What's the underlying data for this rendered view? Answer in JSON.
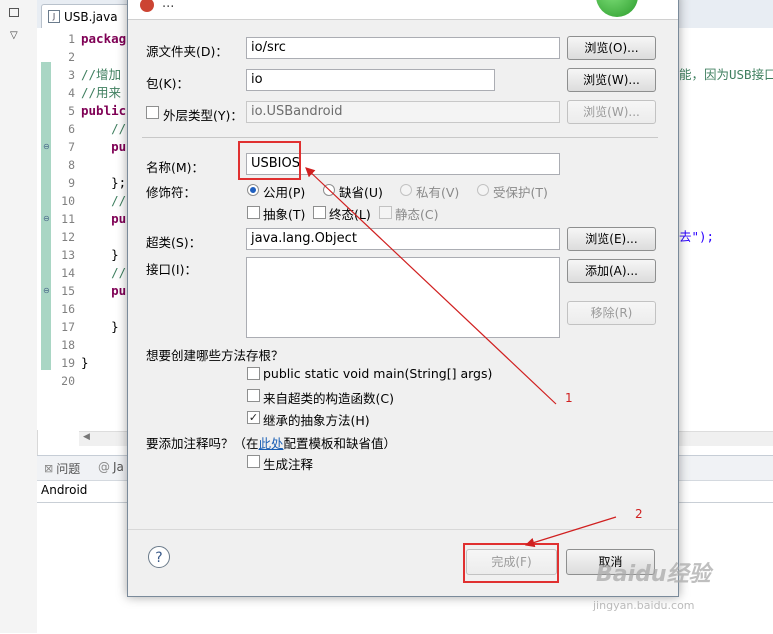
{
  "editor": {
    "tab_label": "USB.java",
    "line_numbers": [
      "1",
      "2",
      "3",
      "4",
      "5",
      "6",
      "7",
      "8",
      "9",
      "10",
      "11",
      "12",
      "13",
      "14",
      "15",
      "16",
      "17",
      "18",
      "19",
      "20"
    ],
    "code_lines": [
      {
        "text": "packag",
        "cls": "kw"
      },
      {
        "text": "",
        "cls": "plain"
      },
      {
        "text": "//增加",
        "cls": "cm"
      },
      {
        "text": "//用来",
        "cls": "cm"
      },
      {
        "text": "public",
        "cls": "kw"
      },
      {
        "text": "    //",
        "cls": "cm"
      },
      {
        "text": "    pu",
        "cls": "kw"
      },
      {
        "text": "",
        "cls": "plain"
      },
      {
        "text": "    };",
        "cls": "plain"
      },
      {
        "text": "    //",
        "cls": "cm"
      },
      {
        "text": "    pu",
        "cls": "kw"
      },
      {
        "text": "",
        "cls": "plain"
      },
      {
        "text": "    }",
        "cls": "plain"
      },
      {
        "text": "    //",
        "cls": "cm"
      },
      {
        "text": "    pu",
        "cls": "kw"
      },
      {
        "text": "",
        "cls": "plain"
      },
      {
        "text": "    }",
        "cls": "plain"
      },
      {
        "text": "",
        "cls": "plain"
      },
      {
        "text": "}",
        "cls": "plain"
      },
      {
        "text": "",
        "cls": "plain"
      }
    ],
    "right_fragment_line3": "能，因为USB接口",
    "right_fragment_line12": "去\");"
  },
  "bottom_panel": {
    "problems_tab": "问题",
    "javadoc_tab": "Ja",
    "content": "Android"
  },
  "dialog": {
    "title": "...",
    "source_folder_label": "源文件夹(D)：",
    "source_folder_value": "io/src",
    "browse_o": "浏览(O)...",
    "package_label": "包(K)：",
    "package_value": "io",
    "browse_w": "浏览(W)...",
    "enclosing_label": "外层类型(Y)：",
    "enclosing_value": "io.USBandroid",
    "browse_w2": "浏览(W)...",
    "name_label": "名称(M)：",
    "name_value": "USBIOS",
    "modifiers_label": "修饰符：",
    "mod_public": "公用(P)",
    "mod_default": "缺省(U)",
    "mod_private": "私有(V)",
    "mod_protected": "受保护(T)",
    "mod_abstract": "抽象(T)",
    "mod_final": "终态(L)",
    "mod_static": "静态(C)",
    "superclass_label": "超类(S)：",
    "superclass_value": "java.lang.Object",
    "browse_e": "浏览(E)...",
    "interfaces_label": "接口(I)：",
    "add_button": "添加(A)...",
    "remove_button": "移除(R)",
    "stubs_question": "想要创建哪些方法存根？",
    "stub_main": "public static void main(String[] args)",
    "stub_constructors": "来自超类的构造函数(C)",
    "stub_inherited": "继承的抽象方法(H)",
    "comments_prefix": "要添加注释吗？（在",
    "comments_link": "此处",
    "comments_suffix": "配置模板和缺省值）",
    "generate_comments": "生成注释",
    "finish_button": "完成(F)",
    "cancel_button": "取消"
  },
  "annotations": {
    "num1": "1",
    "num2": "2",
    "arrow_color": "#d02020"
  },
  "watermark": {
    "brand": "Baidu经验",
    "url": "jingyan.baidu.com"
  }
}
